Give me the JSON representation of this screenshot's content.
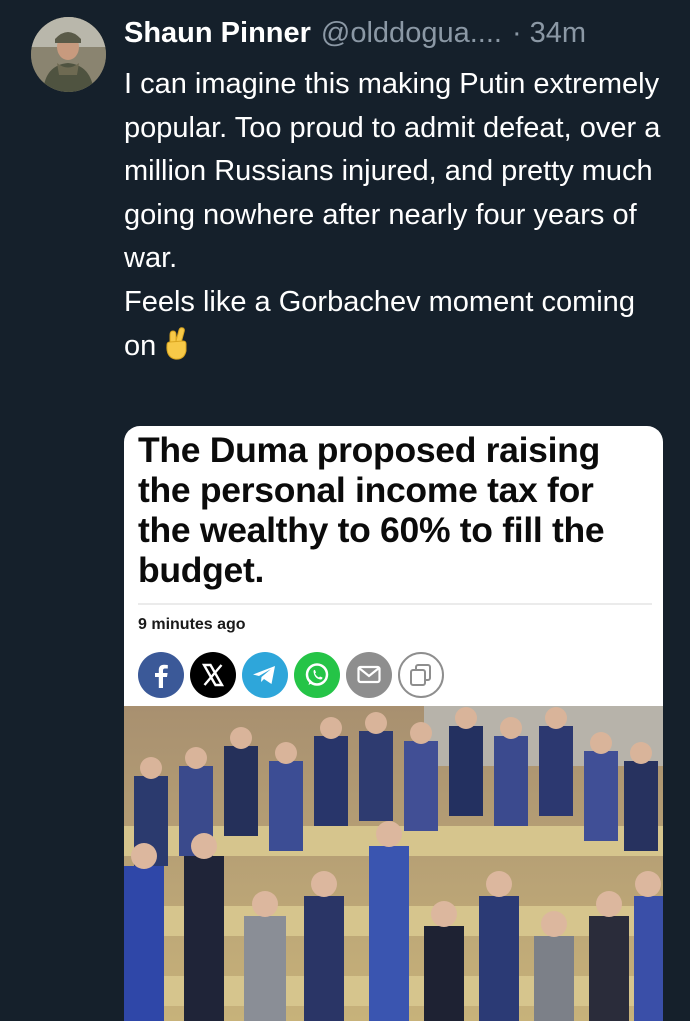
{
  "tweet": {
    "display_name": "Shaun Pinner",
    "handle": "@olddogua....",
    "separator": "·",
    "time": "34m",
    "text_lines": [
      "I can imagine this making Putin extremely popular. Too proud to admit defeat, over a million Russians injured, and pretty much going nowhere after nearly four years of war.",
      "Feels like a Gorbachev moment coming on"
    ],
    "emoji_icon": "crossed-fingers-emoji"
  },
  "card": {
    "headline": "The Duma proposed raising the personal income tax for the wealthy to 60% to fill the budget.",
    "age": "9 minutes ago",
    "share_buttons": [
      {
        "icon": "facebook-icon",
        "color": "#3b5998"
      },
      {
        "icon": "x-icon",
        "color": "#000000"
      },
      {
        "icon": "telegram-icon",
        "color": "#2ea6da"
      },
      {
        "icon": "whatsapp-icon",
        "color": "#25c447"
      },
      {
        "icon": "email-icon",
        "color": "#8e8e8e"
      },
      {
        "icon": "copy-icon",
        "color": "#ffffff"
      }
    ],
    "photo": "duma-chamber-photo"
  }
}
